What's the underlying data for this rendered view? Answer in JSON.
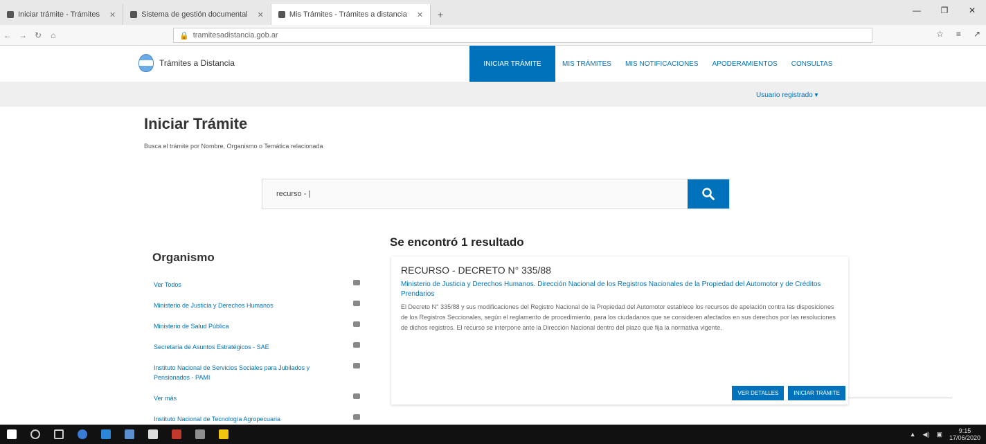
{
  "browser": {
    "tabs": [
      {
        "label": "Iniciar trámite - Trámites",
        "active": false
      },
      {
        "label": "Sistema de gestión documental",
        "active": false
      },
      {
        "label": "Mis Trámites - Trámites a distancia",
        "active": true
      }
    ],
    "url": "tramitesadistancia.gob.ar"
  },
  "site": {
    "logo_text": "Trámites a Distancia",
    "nav": [
      "INICIAR TRÁMITE",
      "MIS TRÁMITES",
      "MIS NOTIFICACIONES",
      "APODERAMIENTOS",
      "CONSULTAS"
    ],
    "user_menu": "Usuario registrado ▾"
  },
  "page": {
    "title": "Iniciar Trámite",
    "description": "Busca el trámite por Nombre, Organismo o Temática relacionada"
  },
  "search": {
    "value": "recurso - |"
  },
  "sidebar": {
    "heading": "Organismo",
    "organismos": [
      "Ver Todos",
      "Ministerio de Justicia y Derechos Humanos",
      "Ministerio de Salud Pública",
      "Secretaría de Asuntos Estratégicos - SAE",
      "Instituto Nacional de Servicios Sociales para Jubilados y Pensionados - PAMI",
      "Ver más",
      "Instituto Nacional de Tecnología Agropecuaria"
    ]
  },
  "results": {
    "summary": "Se encontró 1 resultado",
    "items": [
      {
        "title": "RECURSO - DECRETO N° 335/88",
        "organismo": "Ministerio de Justicia y Derechos Humanos. Dirección Nacional de los Registros Nacionales de la Propiedad del Automotor y de Créditos Prendarios",
        "descripcion": "El Decreto N° 335/88 y sus modificaciones del Registro Nacional de la Propiedad del Automotor establece los recursos de apelación contra las disposiciones de los Registros Seccionales, según el reglamento de procedimiento, para los ciudadanos que se consideren afectados en sus derechos por las resoluciones de dichos registros. El recurso se interpone ante la Dirección Nacional dentro del plazo que fija la normativa vigente.",
        "actions": [
          "VER DETALLES",
          "INICIAR TRÁMITE"
        ]
      }
    ]
  },
  "taskbar": {
    "time": "9:15",
    "date": "17/06/2020"
  },
  "colors": {
    "primary": "#0072bb",
    "taskbar": "#111111"
  }
}
